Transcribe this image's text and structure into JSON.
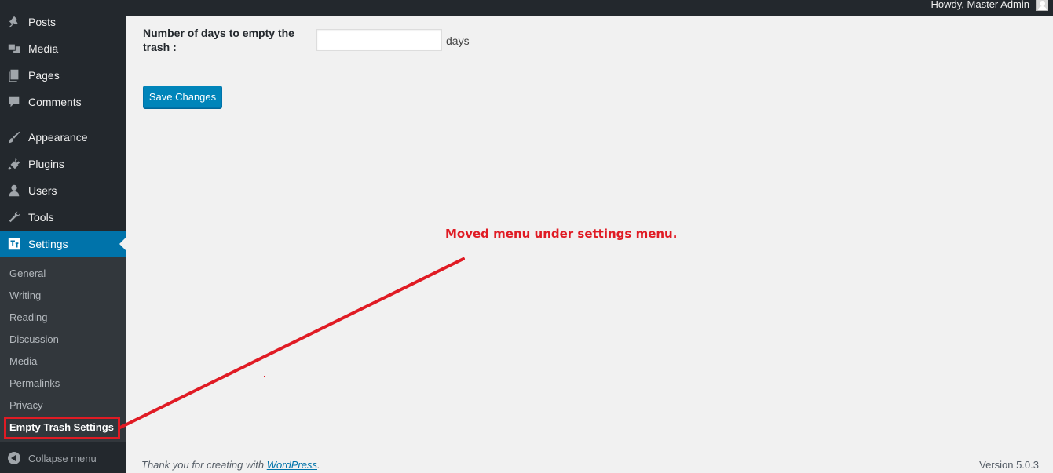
{
  "adminbar": {
    "greeting": "Howdy, Master Admin"
  },
  "sidebar": {
    "items": [
      {
        "label": "Posts",
        "icon": "pin-icon"
      },
      {
        "label": "Media",
        "icon": "media-icon"
      },
      {
        "label": "Pages",
        "icon": "pages-icon"
      },
      {
        "label": "Comments",
        "icon": "comment-icon"
      },
      {
        "label": "Appearance",
        "icon": "brush-icon"
      },
      {
        "label": "Plugins",
        "icon": "plug-icon"
      },
      {
        "label": "Users",
        "icon": "user-icon"
      },
      {
        "label": "Tools",
        "icon": "wrench-icon"
      },
      {
        "label": "Settings",
        "icon": "settings-icon"
      }
    ],
    "submenu": [
      "General",
      "Writing",
      "Reading",
      "Discussion",
      "Media",
      "Permalinks",
      "Privacy",
      "Empty Trash Settings"
    ],
    "collapse_label": "Collapse menu"
  },
  "form": {
    "days_label": "Number of days to empty the trash :",
    "days_value": "",
    "days_unit": "days",
    "save_label": "Save Changes"
  },
  "annotation": {
    "text": "Moved menu under settings menu."
  },
  "footer": {
    "thanks_prefix": "Thank you for creating with ",
    "thanks_link": "WordPress",
    "thanks_suffix": ".",
    "version": "Version 5.0.3"
  },
  "colors": {
    "accent": "#0073aa",
    "annotation": "#e01b24",
    "sidebar": "#23282d"
  }
}
